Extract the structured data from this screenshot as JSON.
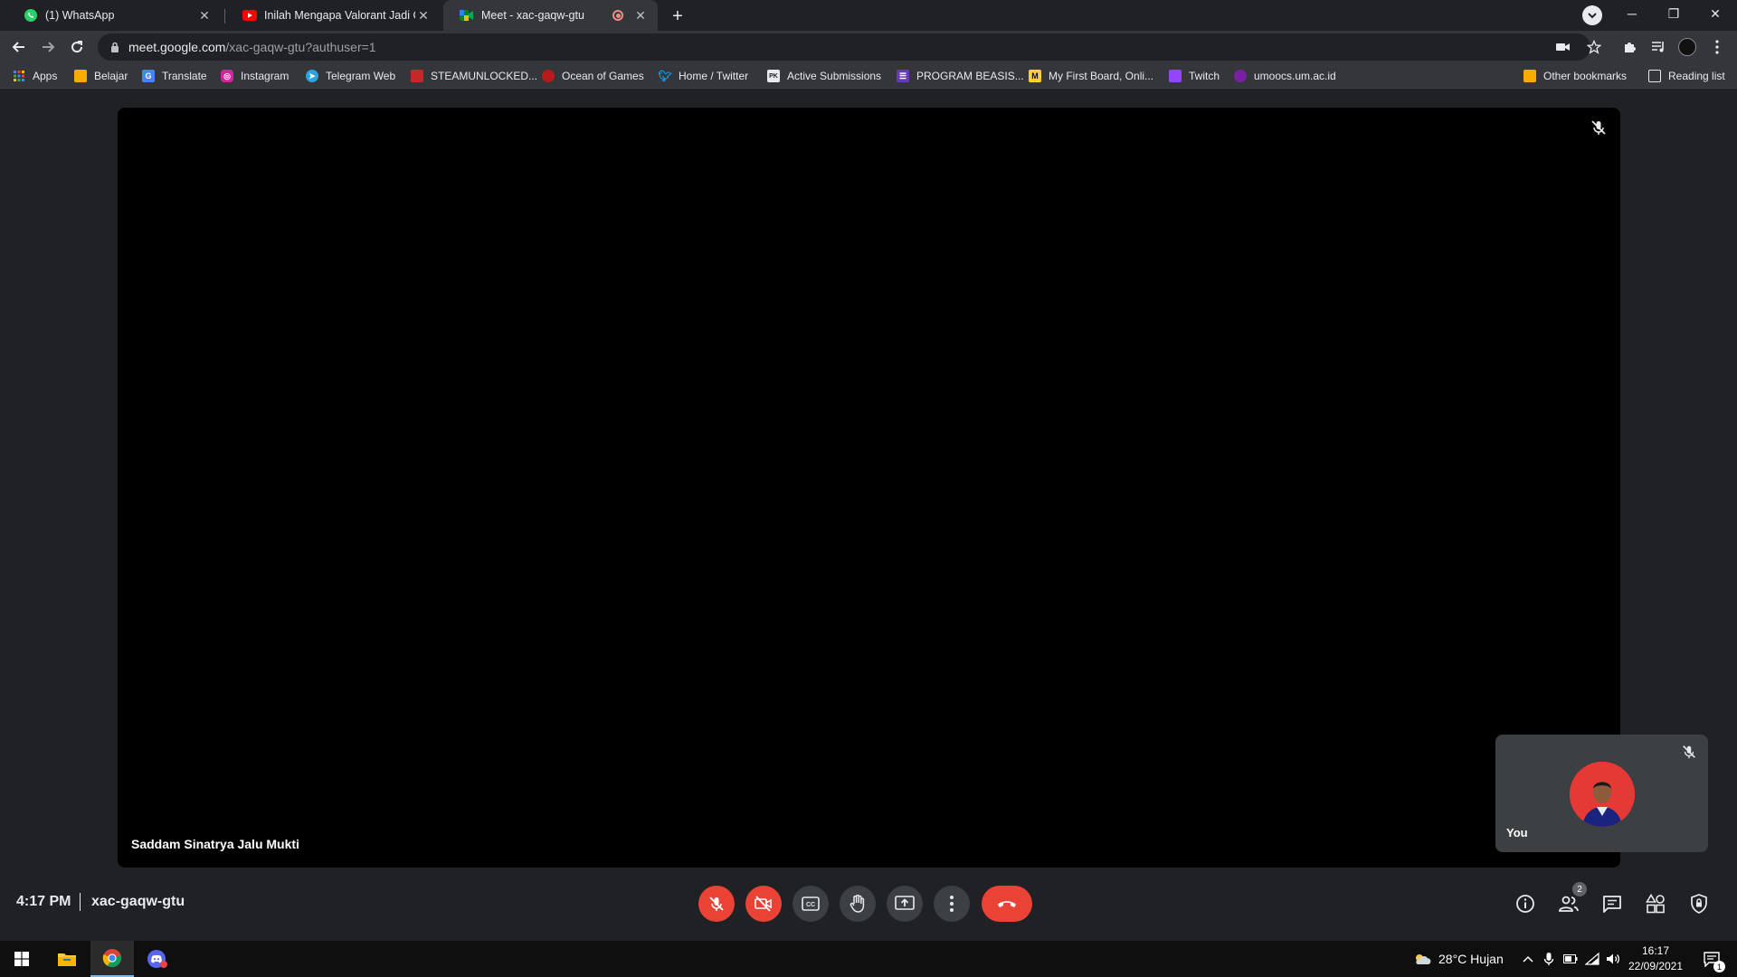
{
  "tabs": [
    {
      "title": "(1) WhatsApp"
    },
    {
      "title": "Inilah Mengapa Valorant Jadi Gam"
    },
    {
      "title": "Meet - xac-gaqw-gtu"
    }
  ],
  "address": {
    "host": "meet.google.com",
    "path": "/xac-gaqw-gtu?authuser=1"
  },
  "bookmarks": [
    {
      "label": "Apps"
    },
    {
      "label": "Belajar"
    },
    {
      "label": "Translate"
    },
    {
      "label": "Instagram"
    },
    {
      "label": "Telegram Web"
    },
    {
      "label": "STEAMUNLOCKED..."
    },
    {
      "label": "Ocean of Games"
    },
    {
      "label": "Home / Twitter"
    },
    {
      "label": "Active Submissions"
    },
    {
      "label": "PROGRAM BEASIS..."
    },
    {
      "label": "My First Board, Onli..."
    },
    {
      "label": "Twitch"
    },
    {
      "label": "umoocs.um.ac.id"
    },
    {
      "label": "Other bookmarks"
    },
    {
      "label": "Reading list"
    }
  ],
  "meet": {
    "main_participant": "Saddam Sinatrya Jalu Mukti",
    "self_label": "You",
    "time": "4:17 PM",
    "meeting_code": "xac-gaqw-gtu",
    "participant_count": "2"
  },
  "taskbar": {
    "weather": "28°C  Hujan",
    "time": "16:17",
    "date": "22/09/2021",
    "notification_count": "1"
  },
  "colors": {
    "meet_bg": "#202124",
    "danger": "#ea4335",
    "control_bg": "#3c4043",
    "tab_active": "#35363a"
  }
}
